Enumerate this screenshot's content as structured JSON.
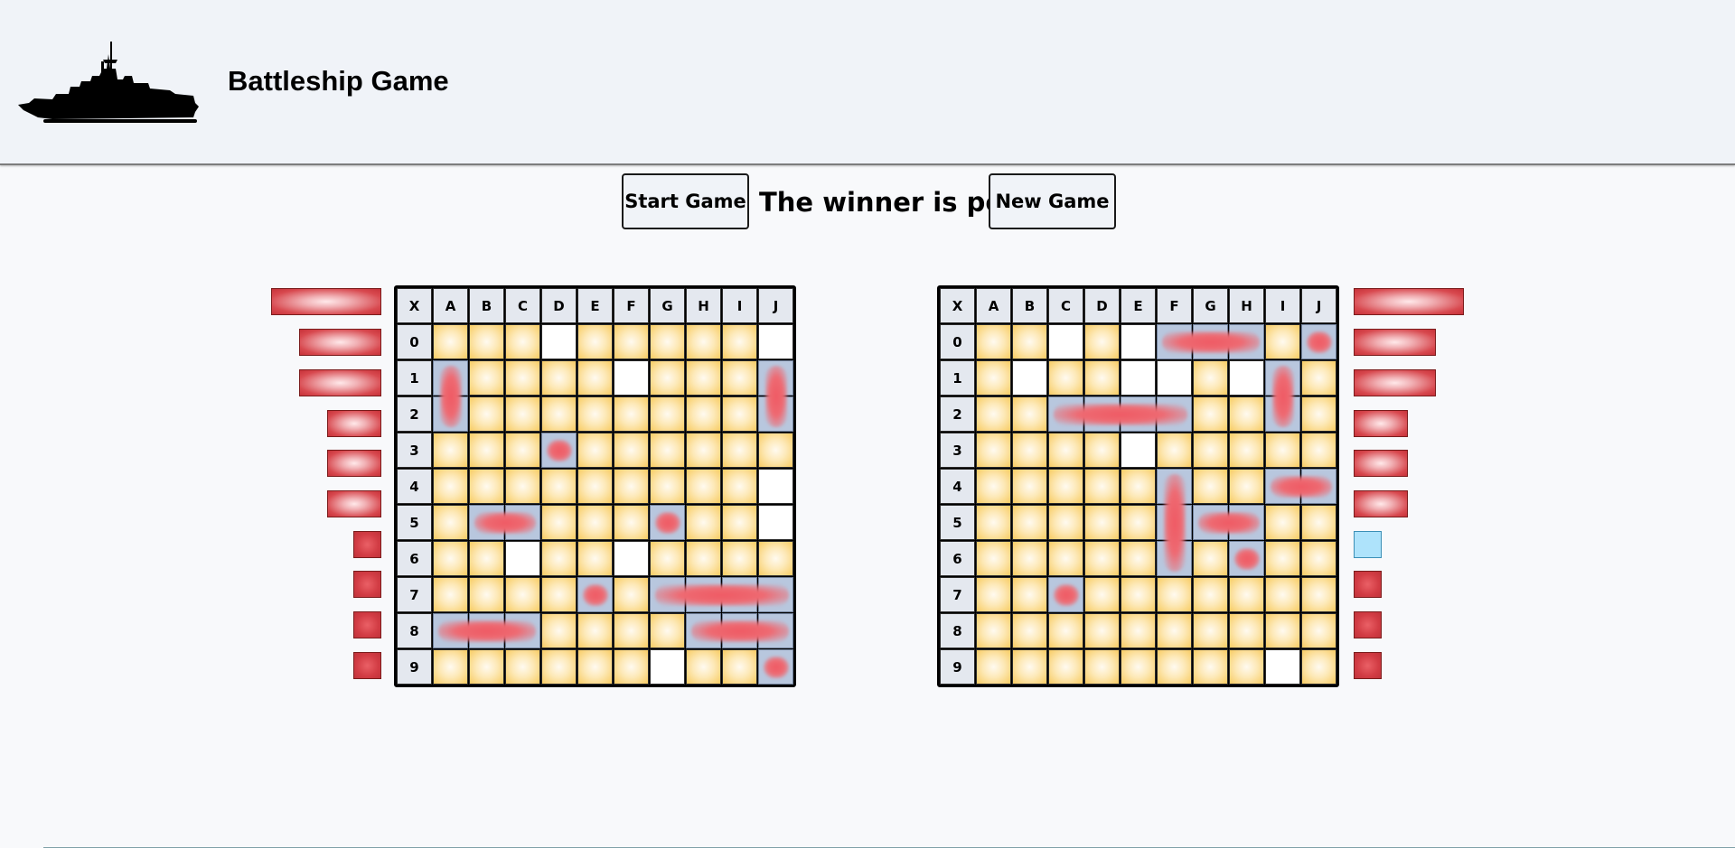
{
  "header": {
    "title": "Battleship Game",
    "logo_icon": "battleship-silhouette-icon"
  },
  "controls": {
    "start_label": "Start Game",
    "status_text": "The winner is pc",
    "new_label": "New Game"
  },
  "board_headers": {
    "corner": "X",
    "columns": [
      "A",
      "B",
      "C",
      "D",
      "E",
      "F",
      "G",
      "H",
      "I",
      "J"
    ],
    "rows": [
      "0",
      "1",
      "2",
      "3",
      "4",
      "5",
      "6",
      "7",
      "8",
      "9"
    ]
  },
  "boards": [
    {
      "id": "player",
      "grid": [
        "...o.....o",
        "s....o...s",
        "s........s",
        "...s......",
        ".........o",
        ".ss...s..o",
        "..o..o....",
        "....s.ssss",
        "sss....sss",
        "......o..s"
      ],
      "ships_hit": [
        {
          "row": 1,
          "col": 0,
          "len": 2,
          "dir": "v"
        },
        {
          "row": 1,
          "col": 9,
          "len": 2,
          "dir": "v"
        },
        {
          "row": 3,
          "col": 3,
          "len": 1,
          "dir": "h"
        },
        {
          "row": 5,
          "col": 1,
          "len": 2,
          "dir": "h"
        },
        {
          "row": 5,
          "col": 6,
          "len": 1,
          "dir": "h"
        },
        {
          "row": 7,
          "col": 4,
          "len": 1,
          "dir": "h"
        },
        {
          "row": 7,
          "col": 6,
          "len": 4,
          "dir": "h"
        },
        {
          "row": 8,
          "col": 0,
          "len": 3,
          "dir": "h"
        },
        {
          "row": 8,
          "col": 7,
          "len": 3,
          "dir": "h"
        },
        {
          "row": 9,
          "col": 9,
          "len": 1,
          "dir": "h"
        }
      ],
      "fleet": [
        {
          "size": 4,
          "status": "sunk"
        },
        {
          "size": 3,
          "status": "sunk"
        },
        {
          "size": 3,
          "status": "sunk"
        },
        {
          "size": 2,
          "status": "sunk"
        },
        {
          "size": 2,
          "status": "sunk"
        },
        {
          "size": 2,
          "status": "sunk"
        },
        {
          "size": 1,
          "status": "sunk"
        },
        {
          "size": 1,
          "status": "sunk"
        },
        {
          "size": 1,
          "status": "sunk"
        },
        {
          "size": 1,
          "status": "sunk"
        }
      ]
    },
    {
      "id": "pc",
      "grid": [
        "..o.osss.s",
        ".o..oo.os.",
        "..ssss..s.",
        "....o.....",
        ".....s..ss",
        ".....sss..",
        ".....s.s..",
        "..s.......",
        "..........",
        "........o."
      ],
      "ships_hit": [
        {
          "row": 0,
          "col": 5,
          "len": 3,
          "dir": "h"
        },
        {
          "row": 0,
          "col": 9,
          "len": 1,
          "dir": "h"
        },
        {
          "row": 1,
          "col": 8,
          "len": 2,
          "dir": "v"
        },
        {
          "row": 2,
          "col": 2,
          "len": 4,
          "dir": "h"
        },
        {
          "row": 4,
          "col": 5,
          "len": 3,
          "dir": "v"
        },
        {
          "row": 4,
          "col": 8,
          "len": 2,
          "dir": "h"
        },
        {
          "row": 5,
          "col": 6,
          "len": 2,
          "dir": "h"
        },
        {
          "row": 6,
          "col": 7,
          "len": 1,
          "dir": "h"
        },
        {
          "row": 7,
          "col": 2,
          "len": 1,
          "dir": "h"
        }
      ],
      "fleet": [
        {
          "size": 4,
          "status": "sunk"
        },
        {
          "size": 3,
          "status": "sunk"
        },
        {
          "size": 3,
          "status": "sunk"
        },
        {
          "size": 2,
          "status": "sunk"
        },
        {
          "size": 2,
          "status": "sunk"
        },
        {
          "size": 2,
          "status": "sunk"
        },
        {
          "size": 1,
          "status": "afloat"
        },
        {
          "size": 1,
          "status": "sunk"
        },
        {
          "size": 1,
          "status": "sunk"
        },
        {
          "size": 1,
          "status": "sunk"
        }
      ]
    }
  ]
}
